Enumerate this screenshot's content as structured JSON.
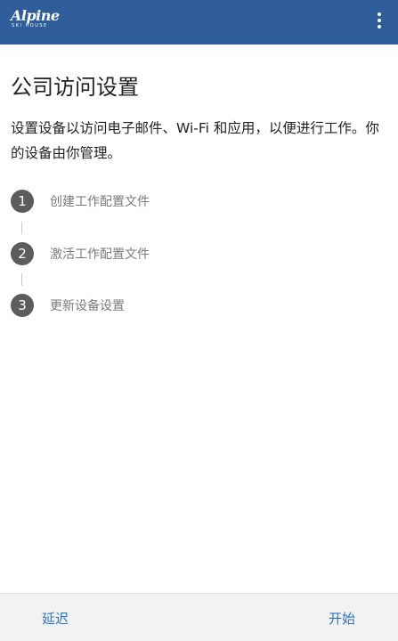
{
  "header": {
    "logo_text": "Alpine",
    "logo_subtext": "SKI HOUSE",
    "menu_icon": "more-vert-icon",
    "background_color": "#2f5d9a"
  },
  "content": {
    "title": "公司访问设置",
    "description": "设置设备以访问电子邮件、Wi-Fi 和应用，以便进行工作。你的设备由你管理。"
  },
  "steps": [
    {
      "number": "1",
      "label": "创建工作配置文件"
    },
    {
      "number": "2",
      "label": "激活工作配置文件"
    },
    {
      "number": "3",
      "label": "更新设备设置"
    }
  ],
  "footer": {
    "skip_label": "延迟",
    "start_label": "开始",
    "accent_color": "#2b73c6"
  }
}
